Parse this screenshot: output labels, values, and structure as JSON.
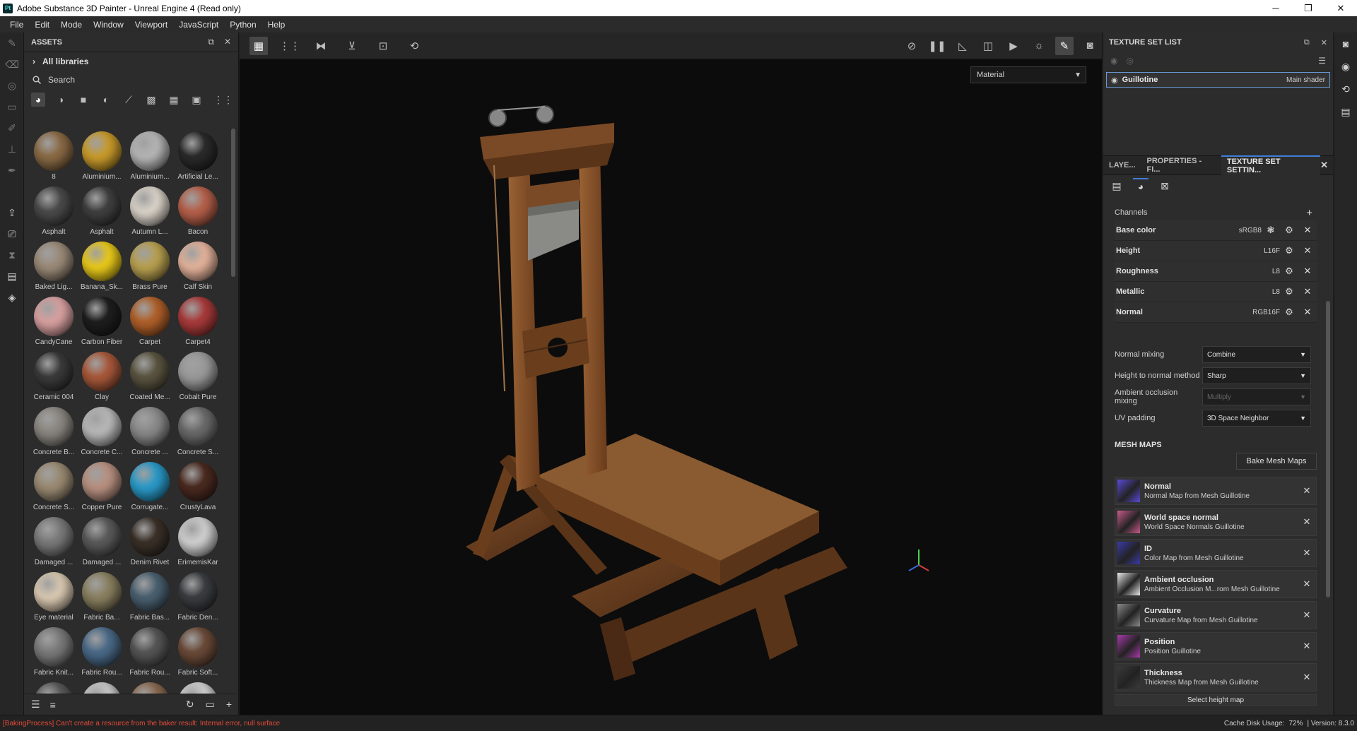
{
  "titlebar": {
    "logo": "Pt",
    "title": "Adobe Substance 3D Painter - Unreal Engine 4 (Read only)",
    "minimize": "─",
    "maximize": "❐",
    "close": "✕"
  },
  "menu": [
    "File",
    "Edit",
    "Mode",
    "Window",
    "Viewport",
    "JavaScript",
    "Python",
    "Help"
  ],
  "assets": {
    "title": "ASSETS",
    "libraries": "All libraries",
    "search_placeholder": "Search",
    "items": [
      {
        "label": "8",
        "color": "#8a6a45"
      },
      {
        "label": "Aluminium...",
        "color": "#c89a2a"
      },
      {
        "label": "Aluminium...",
        "color": "#b5b5b5"
      },
      {
        "label": "Artificial Le...",
        "color": "#2a2a2a"
      },
      {
        "label": "Asphalt",
        "color": "#4a4a4a"
      },
      {
        "label": "Asphalt",
        "color": "#3f3f3f"
      },
      {
        "label": "Autumn L...",
        "color": "#d9d2c8"
      },
      {
        "label": "Bacon",
        "color": "#b5604a"
      },
      {
        "label": "Baked Lig...",
        "color": "#9a8a78"
      },
      {
        "label": "Banana_Sk...",
        "color": "#e8c81a"
      },
      {
        "label": "Brass Pure",
        "color": "#b8a050"
      },
      {
        "label": "Calf Skin",
        "color": "#e3b29a"
      },
      {
        "label": "CandyCane",
        "color": "#d9a0a0"
      },
      {
        "label": "Carbon Fiber",
        "color": "#1e1e1e"
      },
      {
        "label": "Carpet",
        "color": "#b0602a"
      },
      {
        "label": "Carpet4",
        "color": "#a83a3a"
      },
      {
        "label": "Ceramic 004",
        "color": "#3a3a3a"
      },
      {
        "label": "Clay",
        "color": "#a8583a"
      },
      {
        "label": "Coated Me...",
        "color": "#5a5440"
      },
      {
        "label": "Cobalt Pure",
        "color": "#9a9a9a"
      },
      {
        "label": "Concrete B...",
        "color": "#8a8680"
      },
      {
        "label": "Concrete C...",
        "color": "#b8b8b8"
      },
      {
        "label": "Concrete ...",
        "color": "#8a8a8a"
      },
      {
        "label": "Concrete S...",
        "color": "#6a6a6a"
      },
      {
        "label": "Concrete S...",
        "color": "#9a8a72"
      },
      {
        "label": "Copper Pure",
        "color": "#b89080"
      },
      {
        "label": "Corrugate...",
        "color": "#2a9ac8"
      },
      {
        "label": "CrustyLava",
        "color": "#4a2a20"
      },
      {
        "label": "Damaged ...",
        "color": "#7a7a7a"
      },
      {
        "label": "Damaged ...",
        "color": "#5a5a5a"
      },
      {
        "label": "Denim Rivet",
        "color": "#3a3028"
      },
      {
        "label": "ErimemisKar",
        "color": "#cfcfcf"
      },
      {
        "label": "Eye material",
        "color": "#d8c8b0"
      },
      {
        "label": "Fabric Ba...",
        "color": "#8a8060"
      },
      {
        "label": "Fabric Bas...",
        "color": "#4a6070"
      },
      {
        "label": "Fabric Den...",
        "color": "#3a3c40"
      },
      {
        "label": "Fabric Knit...",
        "color": "#7a7a7a"
      },
      {
        "label": "Fabric Rou...",
        "color": "#4a6a88"
      },
      {
        "label": "Fabric Rou...",
        "color": "#555"
      },
      {
        "label": "Fabric Soft...",
        "color": "#6a4a38"
      },
      {
        "label": "",
        "color": "#5a5a5a"
      },
      {
        "label": "",
        "color": "#c8c8c8"
      },
      {
        "label": "",
        "color": "#8a6a50"
      },
      {
        "label": "",
        "color": "#d0d0d0"
      }
    ]
  },
  "viewport": {
    "display_mode": "Material"
  },
  "texture_set_list": {
    "title": "TEXTURE SET LIST",
    "set_name": "Guillotine",
    "shader": "Main shader"
  },
  "tabs": {
    "layers": "LAYE...",
    "properties": "PROPERTIES - FI...",
    "tss": "TEXTURE SET SETTIN..."
  },
  "tss": {
    "channels_label": "Channels",
    "channels": [
      {
        "name": "Base color",
        "format": "sRGB8"
      },
      {
        "name": "Height",
        "format": "L16F"
      },
      {
        "name": "Roughness",
        "format": "L8"
      },
      {
        "name": "Metallic",
        "format": "L8"
      },
      {
        "name": "Normal",
        "format": "RGB16F"
      }
    ],
    "normal_mixing_label": "Normal mixing",
    "normal_mixing_value": "Combine",
    "h2n_label": "Height to normal method",
    "h2n_value": "Sharp",
    "ao_mixing_label": "Ambient occlusion mixing",
    "ao_mixing_value": "Multiply",
    "uv_padding_label": "UV padding",
    "uv_padding_value": "3D Space Neighbor",
    "mesh_maps_title": "MESH MAPS",
    "bake_button": "Bake Mesh Maps",
    "mesh_maps": [
      {
        "name": "Normal",
        "desc": "Normal Map from Mesh Guillotine",
        "color": "#5a4ad8"
      },
      {
        "name": "World space normal",
        "desc": "World Space Normals Guillotine",
        "color": "#c85a8a"
      },
      {
        "name": "ID",
        "desc": "Color Map from Mesh Guillotine",
        "color": "#3a3aa8"
      },
      {
        "name": "Ambient occlusion",
        "desc": "Ambient Occlusion M...rom Mesh Guillotine",
        "color": "#e8e8e8"
      },
      {
        "name": "Curvature",
        "desc": "Curvature Map from Mesh Guillotine",
        "color": "#8a8a8a"
      },
      {
        "name": "Position",
        "desc": "Position Guillotine",
        "color": "#a83aa8"
      },
      {
        "name": "Thickness",
        "desc": "Thickness Map from Mesh Guillotine",
        "color": "#3a3a3a"
      }
    ],
    "select_height": "Select height map"
  },
  "status": {
    "error": "[BakingProcess] Can't create a resource from the baker result: Internal error, null surface",
    "cache": "Cache Disk Usage:",
    "cache_value": "72%",
    "version": "| Version: 8.3.0"
  }
}
